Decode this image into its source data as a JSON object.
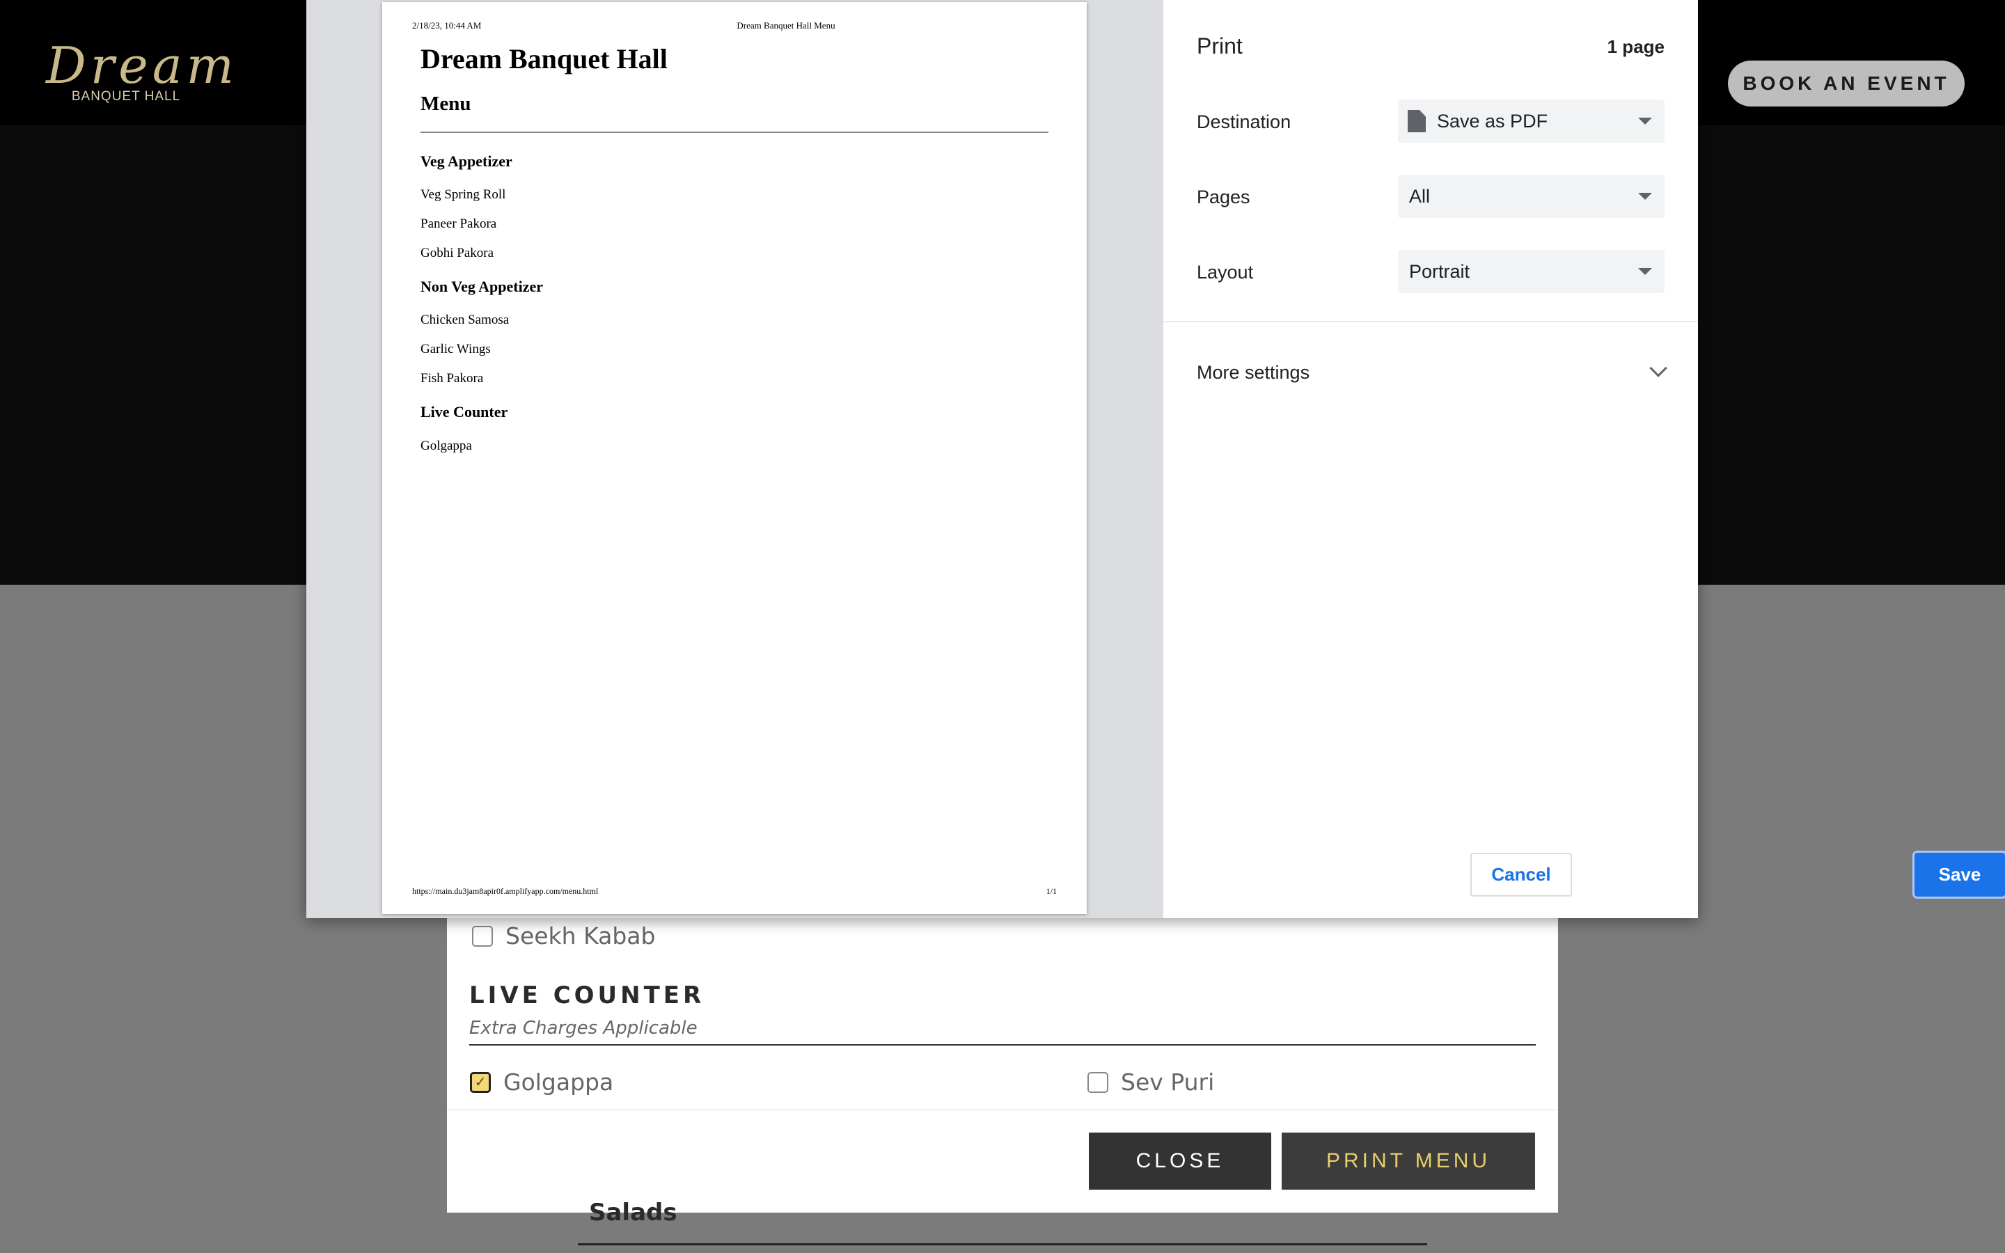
{
  "site": {
    "logo_script": "Dream",
    "logo_sub": "BANQUET HALL",
    "book_button": "BOOK AN EVENT"
  },
  "menu_modal": {
    "items_above": [
      {
        "label": "Seekh Kabab",
        "checked": false
      }
    ],
    "section_title": "LIVE COUNTER",
    "section_subtitle": "Extra Charges Applicable",
    "section_items": [
      {
        "label": "Golgappa",
        "checked": true
      },
      {
        "label": "Sev Puri",
        "checked": false
      }
    ],
    "close_button": "CLOSE",
    "print_button": "PRINT MENU",
    "next_section_peek": "Salads"
  },
  "print_preview": {
    "header_date": "2/18/23, 10:44 AM",
    "header_title": "Dream Banquet Hall Menu",
    "title": "Dream Banquet Hall",
    "subtitle": "Menu",
    "categories": [
      {
        "name": "Veg Appetizer",
        "items": [
          "Veg Spring Roll",
          "Paneer Pakora",
          "Gobhi Pakora"
        ]
      },
      {
        "name": "Non Veg Appetizer",
        "items": [
          "Chicken Samosa",
          "Garlic Wings",
          "Fish Pakora"
        ]
      },
      {
        "name": "Live Counter",
        "items": [
          "Golgappa"
        ]
      }
    ],
    "footer_url": "https://main.du3jam8apir0f.amplifyapp.com/menu.html",
    "footer_page": "1/1"
  },
  "print_settings": {
    "title": "Print",
    "page_count": "1 page",
    "destination_label": "Destination",
    "destination_value": "Save as PDF",
    "pages_label": "Pages",
    "pages_value": "All",
    "layout_label": "Layout",
    "layout_value": "Portrait",
    "more_settings": "More settings",
    "cancel_button": "Cancel",
    "save_button": "Save",
    "accent_color": "#1a73e8"
  }
}
